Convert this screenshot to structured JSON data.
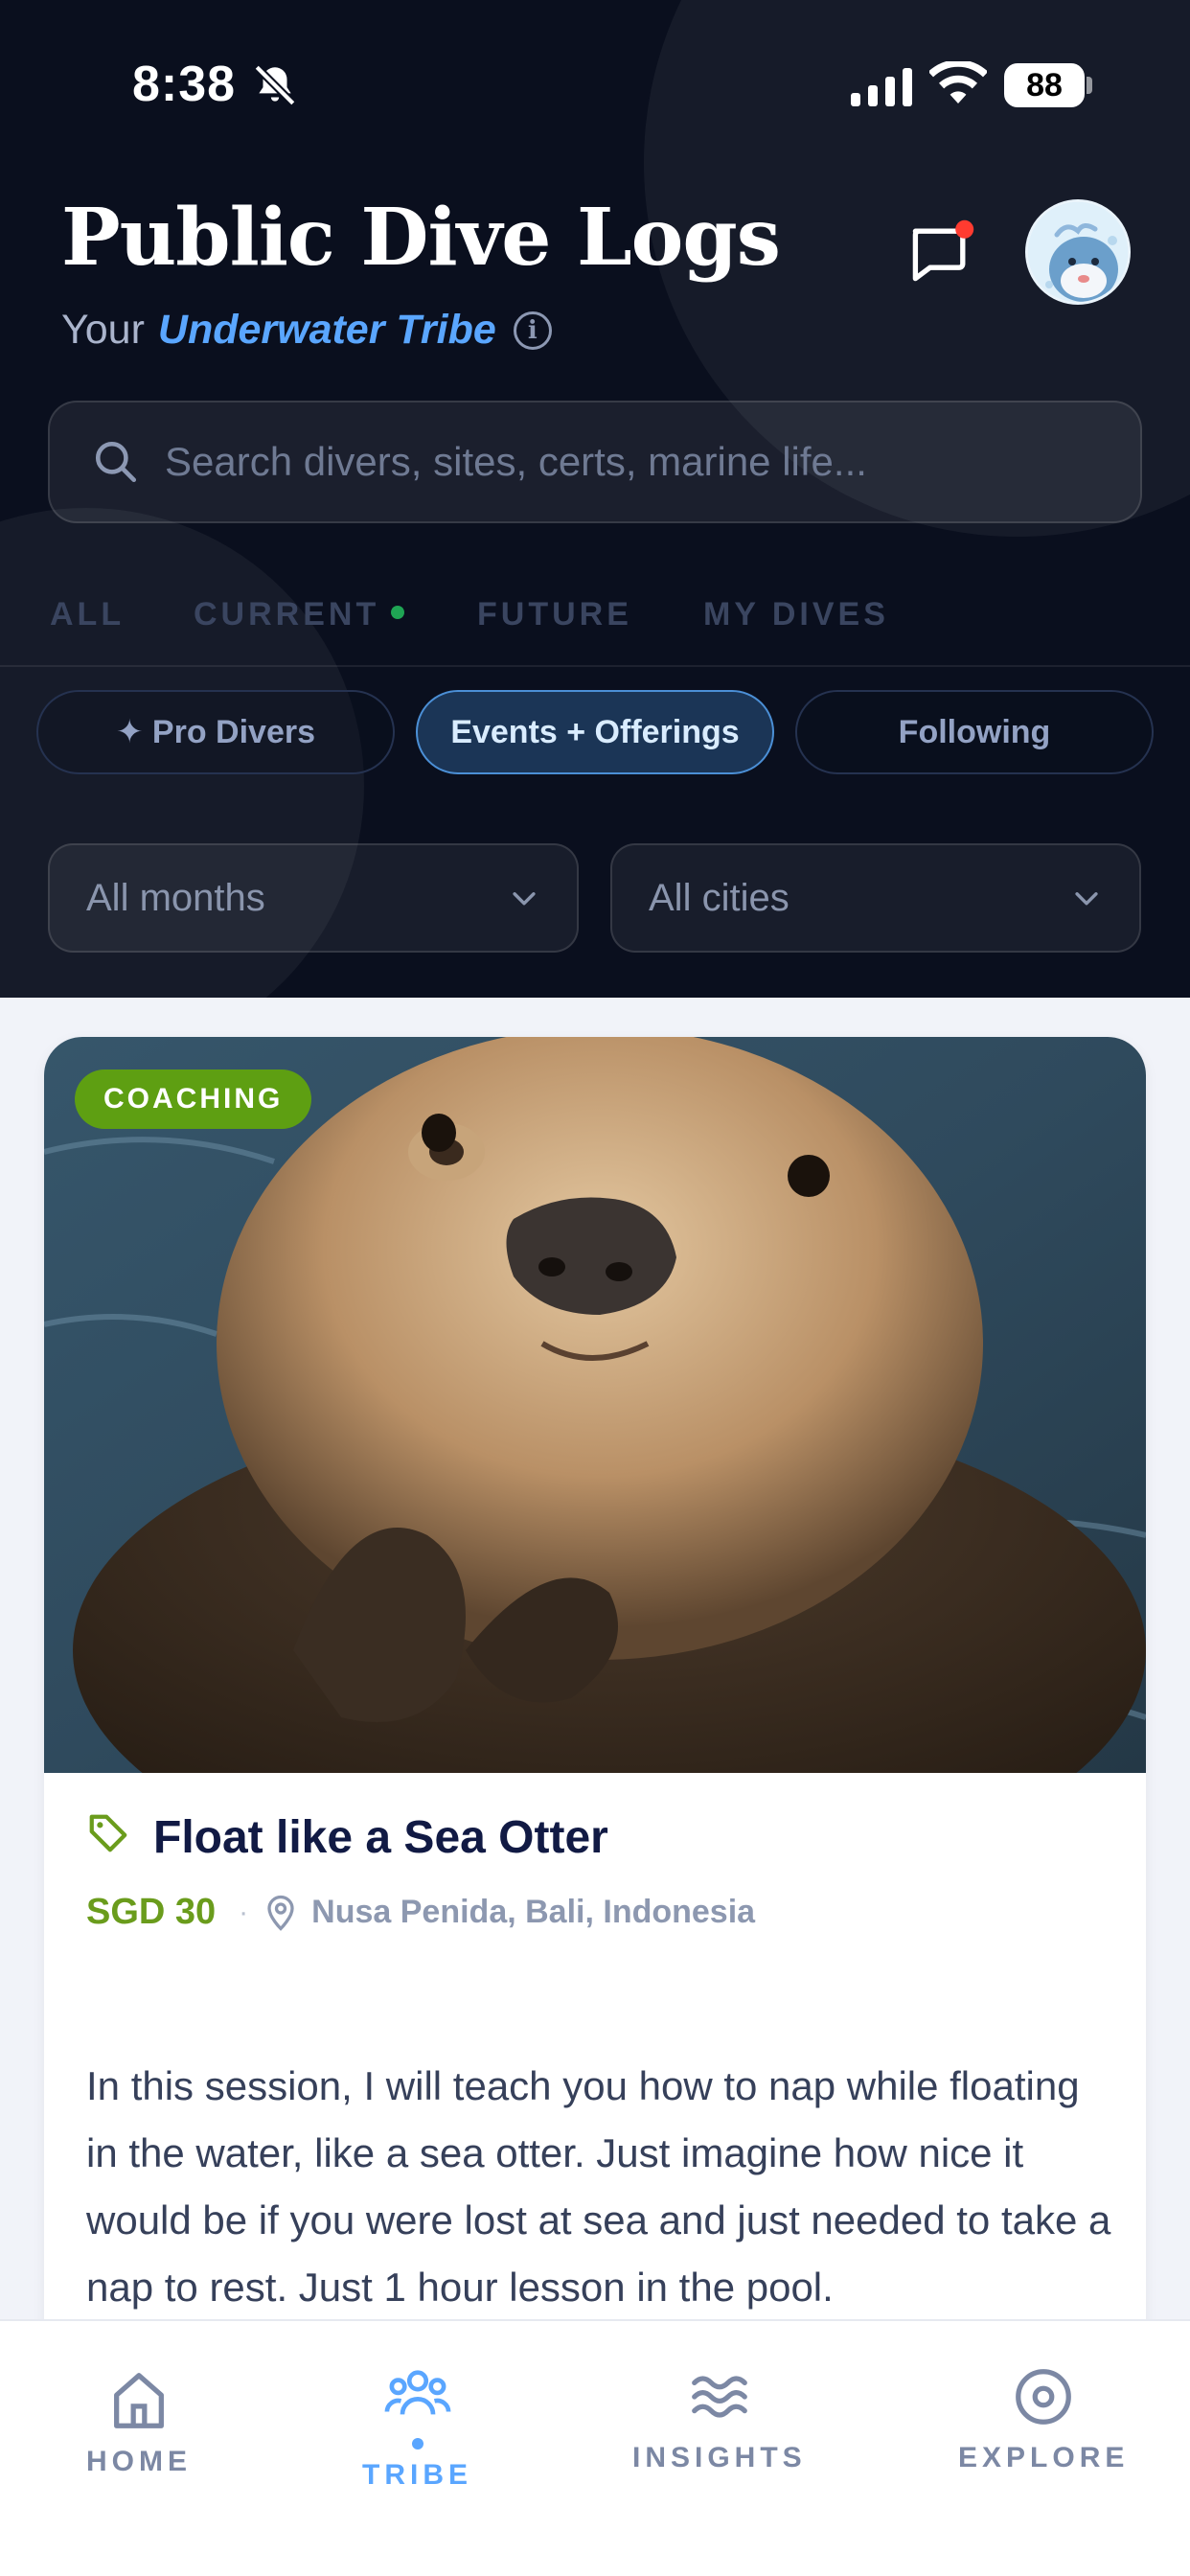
{
  "status_bar": {
    "time": "8:38",
    "battery": "88"
  },
  "header": {
    "title": "Public Dive Logs",
    "subtitle_prefix": "Your",
    "subtitle_accent": "Underwater Tribe",
    "info_icon": "i"
  },
  "search": {
    "placeholder": "Search divers, sites, certs, marine life..."
  },
  "tabs": [
    {
      "label": "ALL"
    },
    {
      "label": "CURRENT"
    },
    {
      "label": "FUTURE"
    },
    {
      "label": "MY DIVES"
    }
  ],
  "chips": [
    {
      "label": "✦ Pro Divers",
      "active": false
    },
    {
      "label": "Events + Offerings",
      "active": true
    },
    {
      "label": "Following",
      "active": false
    }
  ],
  "filters": {
    "months": "All months",
    "cities": "All cities"
  },
  "card": {
    "badge": "COACHING",
    "title": "Float like a Sea Otter",
    "price": "SGD 30",
    "separator": "·",
    "location": "Nusa Penida, Bali, Indonesia",
    "description": "In this session, I will teach you how to nap while floating in the water, like a sea otter. Just imagine how nice it would be if you were lost at sea and just needed to take a nap to rest. Just 1 hour lesson in the pool."
  },
  "bottom_nav": [
    {
      "label": "HOME",
      "icon": "home-icon"
    },
    {
      "label": "TRIBE",
      "icon": "tribe-icon",
      "active": true
    },
    {
      "label": "INSIGHTS",
      "icon": "waves-icon"
    },
    {
      "label": "EXPLORE",
      "icon": "explore-icon"
    }
  ],
  "colors": {
    "header_bg": "#0a0f1e",
    "accent": "#5aa6ff",
    "badge_green": "#5e9f12",
    "price_green": "#6a9c1c",
    "current_dot": "#1fa454",
    "notification_dot": "#ff3b30"
  }
}
